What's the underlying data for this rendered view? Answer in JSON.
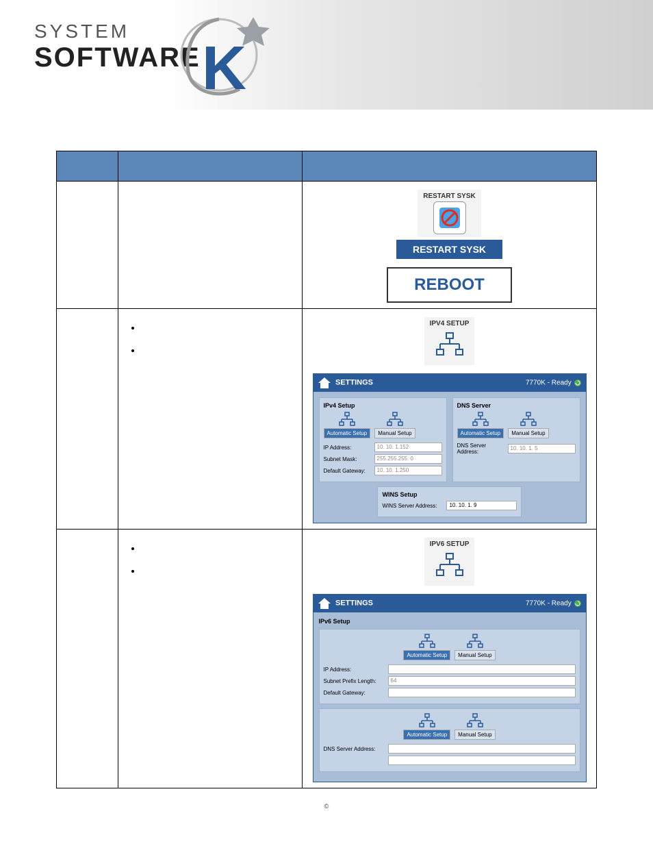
{
  "header": {
    "line1": "SYSTEM",
    "line2": "SOFTWARE"
  },
  "table": {
    "rows": [
      {
        "col1": "",
        "col2": "",
        "restart_label": "RESTART SYSK",
        "restart_bar": "RESTART SYSK",
        "reboot_btn": "REBOOT"
      },
      {
        "col1": "",
        "col2_bullets": [
          "",
          ""
        ],
        "icon_label": "IPV4 SETUP",
        "panel": {
          "title": "SETTINGS",
          "status": "7770K - Ready",
          "ipv4": {
            "title": "IPv4 Setup",
            "auto": "Automatic Setup",
            "manual": "Manual Setup",
            "ip_label": "IP Address:",
            "ip_value": "10. 10.  1.152",
            "mask_label": "Subnet Mask:",
            "mask_value": "255.255.255.  0",
            "gw_label": "Default Gateway:",
            "gw_value": "10. 10.  1.250"
          },
          "dns": {
            "title": "DNS Server",
            "auto": "Automatic Setup",
            "manual": "Manual Setup",
            "addr_label": "DNS Server Address:",
            "addr_value": "10. 10.  1.  5"
          },
          "wins": {
            "title": "WINS Setup",
            "addr_label": "WINS Server Address:",
            "addr_value": "10. 10.  1.  9"
          }
        }
      },
      {
        "col1": "",
        "col2_bullets": [
          "",
          ""
        ],
        "icon_label": "IPV6 SETUP",
        "panel": {
          "title": "SETTINGS",
          "status": "7770K - Ready",
          "ipv6": {
            "title": "IPv6 Setup",
            "auto": "Automatic Setup",
            "manual": "Manual Setup",
            "ip_label": "IP Address:",
            "ip_value": "",
            "prefix_label": "Subnet Prefix Length:",
            "prefix_value": "64",
            "gw_label": "Default Gateway:",
            "gw_value": "",
            "dns_auto": "Automatic Setup",
            "dns_manual": "Manual Setup",
            "dns_label": "DNS Server Address:",
            "dns_value": ""
          }
        }
      }
    ]
  },
  "footer": {
    "copyright": "©"
  }
}
